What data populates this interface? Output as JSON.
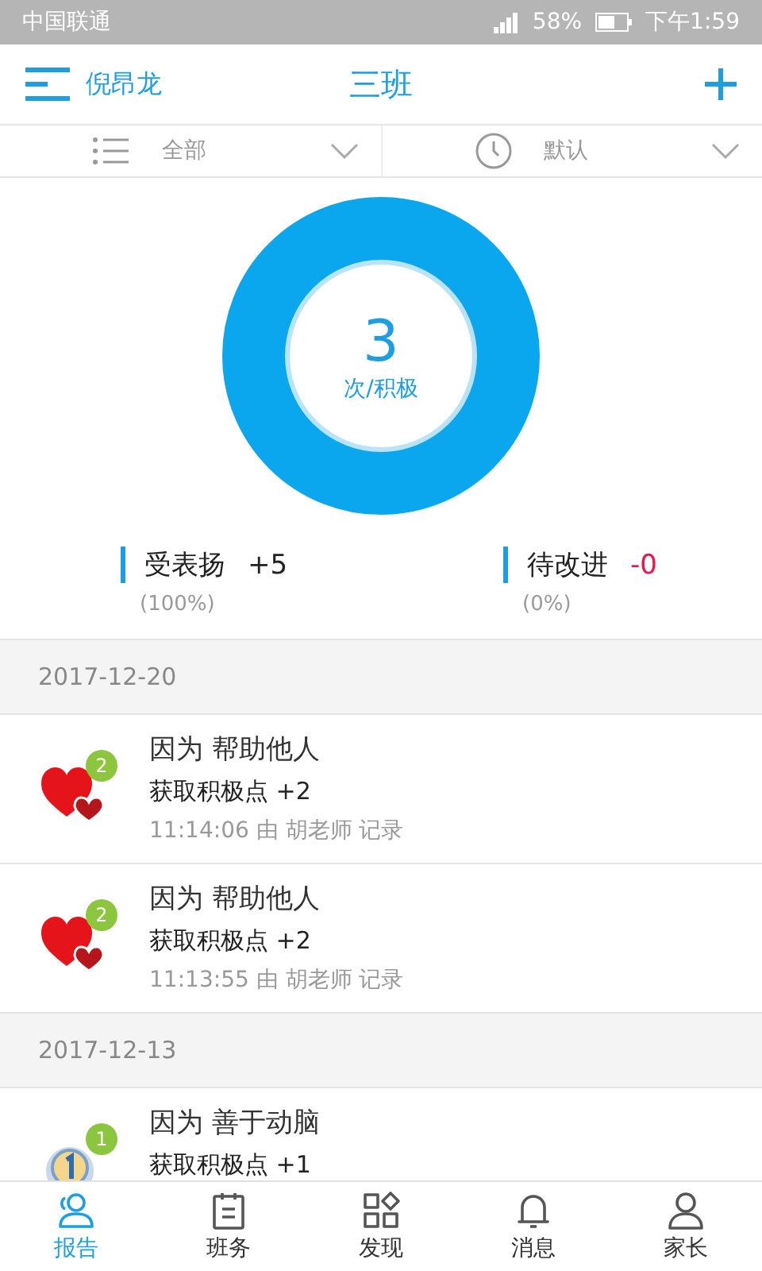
{
  "status_bar": {
    "carrier": "中国联通",
    "battery": "58%",
    "time": "下午1:59"
  },
  "header": {
    "user": "倪昂龙",
    "title": "三班"
  },
  "filters": [
    {
      "label": "全部"
    },
    {
      "label": "默认"
    }
  ],
  "summary": {
    "count": "3",
    "unit": "次/积极"
  },
  "stats": [
    {
      "label": "受表扬",
      "value": "+5",
      "percent": "(100%)",
      "kind": "positive"
    },
    {
      "label": "待改进",
      "value": "-0",
      "percent": "(0%)",
      "kind": "negative"
    }
  ],
  "groups": [
    {
      "date": "2017-12-20",
      "records": [
        {
          "kind": "hearts",
          "badge": "2",
          "reason": "因为 帮助他人",
          "points": "获取积极点 +2",
          "meta": "11:14:06 由 胡老师 记录"
        },
        {
          "kind": "hearts",
          "badge": "2",
          "reason": "因为 帮助他人",
          "points": "获取积极点 +2",
          "meta": "11:13:55 由 胡老师 记录"
        }
      ]
    },
    {
      "date": "2017-12-13",
      "records": [
        {
          "kind": "medal",
          "badge": "1",
          "reason": "因为 善于动脑",
          "points": "获取积极点 +1"
        }
      ]
    }
  ],
  "tabs": [
    {
      "label": "报告",
      "selected": true
    },
    {
      "label": "班务",
      "selected": false
    },
    {
      "label": "发现",
      "selected": false
    },
    {
      "label": "消息",
      "selected": false
    },
    {
      "label": "家长",
      "selected": false
    }
  ]
}
